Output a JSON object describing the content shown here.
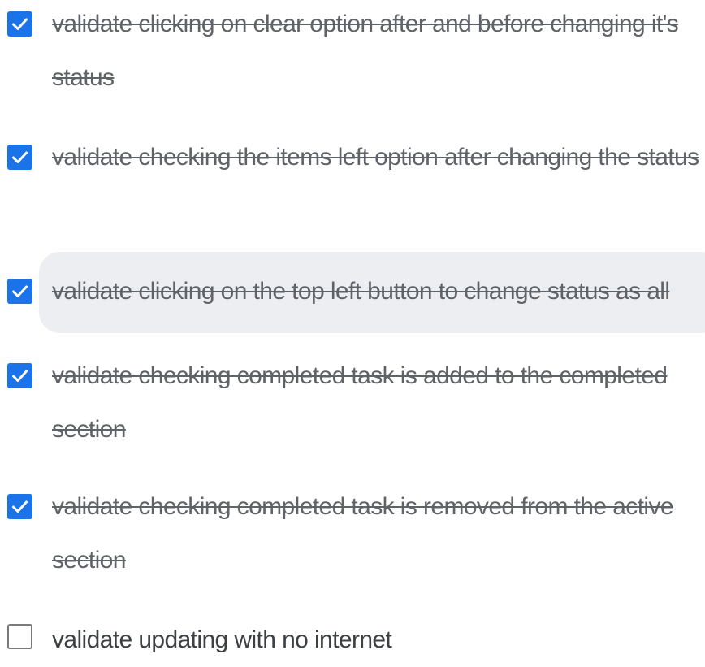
{
  "accent_color": "#1a73e8",
  "tasks": [
    {
      "text": "validate clicking on clear option after and before changing it's status",
      "checked": true
    },
    {
      "text": "validate checking the items left option after changing the status",
      "checked": true
    },
    {
      "text": "validate clicking on the top left button to change status as all",
      "checked": true,
      "hovered": true
    },
    {
      "text": "validate checking completed task is added to the completed section",
      "checked": true
    },
    {
      "text": "validate checking completed task is removed from the active section",
      "checked": true
    },
    {
      "text": "validate updating with no internet",
      "checked": false
    }
  ]
}
